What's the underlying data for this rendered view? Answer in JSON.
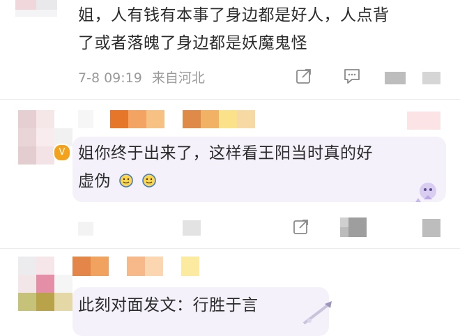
{
  "comment1": {
    "text_line1": "姐，人有钱有本事了身边都是好人，人点背",
    "text_line2": "了或者落魄了身边都是妖魔鬼怪",
    "timestamp": "7-8 09:19",
    "location": "来自河北"
  },
  "comment2": {
    "text_line1": "姐你终于出来了，这样看王阳当时真的好",
    "text_line2": "虚伪",
    "emojis": [
      "smiley-emoji",
      "smiley-emoji"
    ]
  },
  "comment3": {
    "text": "此刻对面发文：行胜于言"
  },
  "colors": {
    "bubble_bg": "#f4f1fb",
    "text": "#2b2b2b",
    "meta": "#9a9a9a",
    "orange": "#e5762a",
    "verified_badge": "#f3a21c"
  }
}
